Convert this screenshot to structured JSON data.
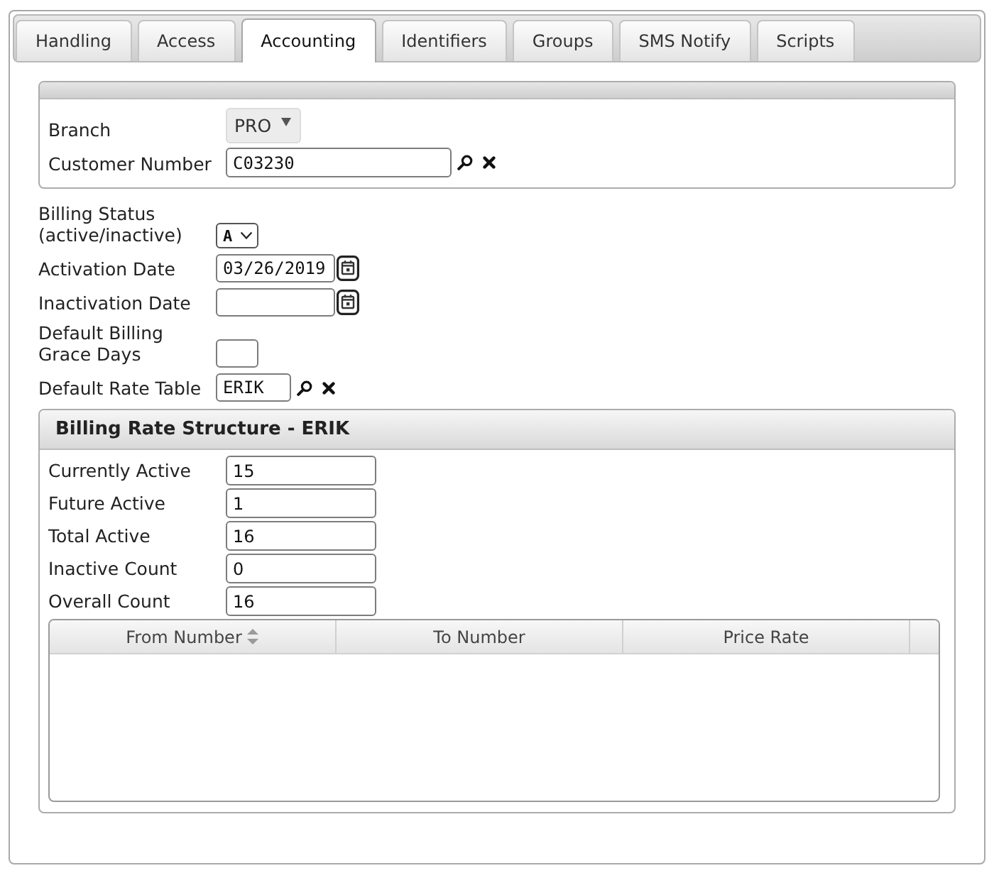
{
  "tabs": [
    {
      "label": "Handling",
      "selected": false
    },
    {
      "label": "Access",
      "selected": false
    },
    {
      "label": "Accounting",
      "selected": true
    },
    {
      "label": "Identifiers",
      "selected": false
    },
    {
      "label": "Groups",
      "selected": false
    },
    {
      "label": "SMS Notify",
      "selected": false
    },
    {
      "label": "Scripts",
      "selected": false
    }
  ],
  "account": {
    "fields": [
      {
        "kind": "menu",
        "label": "Branch",
        "value": "PRO"
      },
      {
        "kind": "lookup",
        "label": "Customer Number",
        "value": "C03230"
      }
    ]
  },
  "billing": [
    {
      "kind": "select",
      "label": "Billing Status\n(active/inactive)",
      "value": "A"
    },
    {
      "kind": "date",
      "label": "Activation Date",
      "value": "03/26/2019"
    },
    {
      "kind": "date",
      "label": "Inactivation Date"
    },
    {
      "kind": "text",
      "label": "Default Billing\nGrace Days"
    },
    {
      "kind": "lookup",
      "label": "Default Rate Table",
      "value": "ERIK"
    }
  ],
  "rate_structure": {
    "title": "Billing Rate Structure - ERIK",
    "counts": [
      {
        "label": "Currently Active",
        "value": "15"
      },
      {
        "label": "Future Active",
        "value": "1"
      },
      {
        "label": "Total Active",
        "value": "16"
      },
      {
        "label": "Inactive Count",
        "value": "0"
      },
      {
        "label": "Overall Count",
        "value": "16"
      }
    ],
    "table": {
      "columns": [
        {
          "label": "From Number",
          "sortable": true
        },
        {
          "label": "To Number",
          "sortable": false
        },
        {
          "label": "Price Rate",
          "sortable": false
        }
      ]
    }
  }
}
